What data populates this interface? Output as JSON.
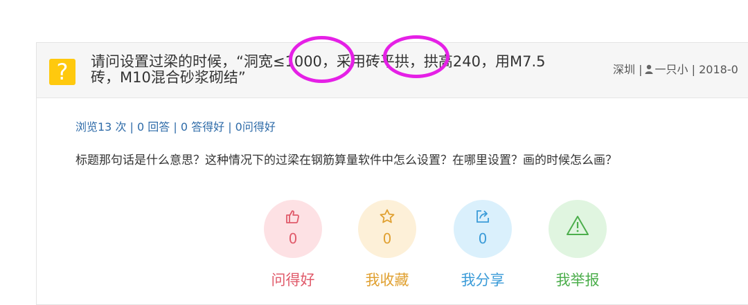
{
  "question": {
    "title": "请问设置过梁的时候，“洞宽≤1000，采用砖平拱，拱高240，用M7.5砖，M10混合砂浆砌结”",
    "location": "深圳",
    "separator": "|",
    "user": "一只小",
    "date": "2018-0",
    "icon": "question-mark-icon"
  },
  "stats": {
    "text": "浏览13 次 | 0 回答 | 0 答得好 | 0问得好"
  },
  "body": {
    "text": "标题那句话是什么意思？这种情况下的过梁在钢筋算量软件中怎么设置？在哪里设置？画的时候怎么画？"
  },
  "actions": [
    {
      "label": "问得好",
      "count": "0",
      "icon": "thumbs-up-icon",
      "color": "#e05a6a",
      "bg": "#fde1e4"
    },
    {
      "label": "我收藏",
      "count": "0",
      "icon": "star-icon",
      "color": "#e0a030",
      "bg": "#fdf0d8"
    },
    {
      "label": "我分享",
      "count": "0",
      "icon": "share-icon",
      "color": "#3a9bd8",
      "bg": "#daf0fc"
    },
    {
      "label": "我举报",
      "count": "0",
      "icon": "warning-icon",
      "color": "#4cae4c",
      "bg": "#e0f5e0"
    }
  ],
  "colors": {
    "accent_question": "#ffc90e",
    "link_blue": "#2e6ba8",
    "annotation_magenta": "#e520e6"
  }
}
